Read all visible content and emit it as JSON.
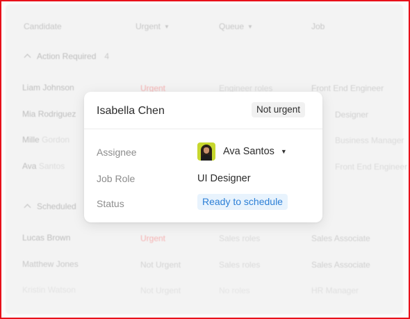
{
  "table": {
    "headers": {
      "candidate": "Candidate",
      "urgent": "Urgent",
      "queue": "Queue",
      "job": "Job"
    },
    "groups": [
      {
        "label": "Action Required",
        "count": "4"
      },
      {
        "label": "Scheduled"
      }
    ],
    "rows": [
      {
        "first": "Liam",
        "last": "Johnson",
        "urgency": "Urgent",
        "queue": "Engineer roles",
        "job": "Front End Engineer"
      },
      {
        "first": "Mia",
        "last": "Rodriguez",
        "urgency": "",
        "queue": "",
        "job": "Designer"
      },
      {
        "first": "Mille",
        "last": "Gordon",
        "urgency": "",
        "queue": "",
        "job": "Business Manager"
      },
      {
        "first": "Ava",
        "last": "Santos",
        "urgency": "",
        "queue": "",
        "job": "Front End Engineer"
      },
      {
        "first": "Lucas",
        "last": "Brown",
        "urgency": "Urgent",
        "queue": "Sales roles",
        "job": "Sales Associate"
      },
      {
        "first": "Matthew",
        "last": "Jones",
        "urgency": "Not Urgent",
        "queue": "Sales roles",
        "job": "Sales Associate"
      },
      {
        "first": "Kristin",
        "last": "Watson",
        "urgency": "Not Urgent",
        "queue": "No roles",
        "job": "HR Manager"
      }
    ]
  },
  "popup": {
    "candidate_name": "Isabella Chen",
    "urgency": "Not urgent",
    "labels": {
      "assignee": "Assignee",
      "job_role": "Job Role",
      "status": "Status"
    },
    "assignee": "Ava Santos",
    "job_role": "UI Designer",
    "status": "Ready to schedule"
  },
  "colors": {
    "frame_border": "#e8101a",
    "status_text": "#2c7fd6",
    "status_bg": "#e8f3fd",
    "urgent_text": "#f4b3b3"
  },
  "icons": {
    "group_toggle": "chevron-up-icon",
    "sort": "caret-down-icon",
    "assignee_dropdown": "caret-down-icon"
  }
}
